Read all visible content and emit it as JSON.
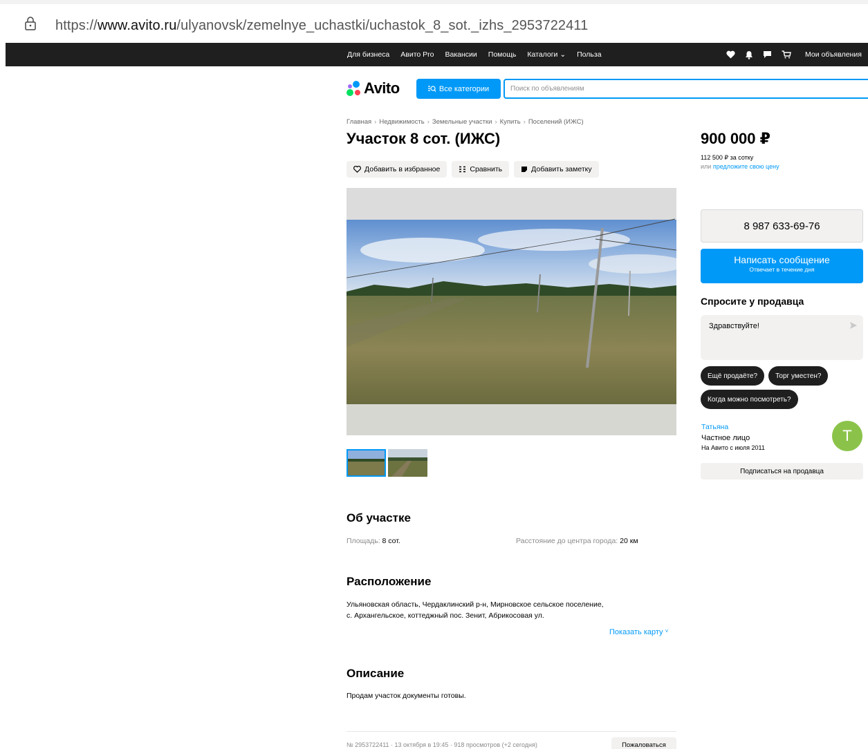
{
  "browser": {
    "url_prefix": "https://",
    "url_host": "www.avito.ru",
    "url_path": "/ulyanovsk/zemelnye_uchastki/uchastok_8_sot._izhs_2953722411"
  },
  "topnav": {
    "links": [
      "Для бизнеса",
      "Авито Pro",
      "Вакансии",
      "Помощь",
      "Каталоги",
      "Польза"
    ],
    "my_ads": "Мои объявления"
  },
  "header": {
    "logo": "Avito",
    "categories_button": "Все категории",
    "search_placeholder": "Поиск по объявлениям"
  },
  "breadcrumb": [
    "Главная",
    "Недвижимость",
    "Земельные участки",
    "Купить",
    "Поселений (ИЖС)"
  ],
  "listing": {
    "title": "Участок 8 сот. (ИЖС)",
    "actions": {
      "favorite": "Добавить в избранное",
      "compare": "Сравнить",
      "note": "Добавить заметку"
    },
    "photo_count": 2
  },
  "about": {
    "heading": "Об участке",
    "area_label": "Площадь:",
    "area_value": "8 сот.",
    "distance_label": "Расстояние до центра города:",
    "distance_value": "20 км"
  },
  "location": {
    "heading": "Расположение",
    "address": "Ульяновская область, Чердаклинский р-н, Мирновское сельское поселение, с. Архангельское, коттеджный пос. Зенит, Абрикосовая ул.",
    "show_map": "Показать карту"
  },
  "description": {
    "heading": "Описание",
    "text": "Продам участок документы готовы."
  },
  "footer": {
    "meta": "№ 2953722411 · 13 октября в 19:45 · 918 просмотров (+2 сегодня)",
    "complain": "Пожаловаться"
  },
  "sidebar": {
    "price": "900 000 ₽",
    "per_sotka": "112 500 ₽ за сотку",
    "offer_prefix": "или",
    "offer_link": "предложите свою цену",
    "phone": "8 987 633-69-76",
    "message_button": "Написать сообщение",
    "message_sub": "Отвечает в течение дня",
    "ask_title": "Спросите у продавца",
    "ask_text": "Здравствуйте!",
    "chips": [
      "Ещё продаёте?",
      "Торг уместен?",
      "Когда можно посмотреть?"
    ],
    "seller_name": "Татьяна",
    "seller_type": "Частное лицо",
    "seller_since": "На Авито с июля 2011",
    "avatar_letter": "Т",
    "subscribe": "Подписаться на продавца"
  },
  "colors": {
    "accent": "#0099f7",
    "dark": "#1f1f1f",
    "avatar": "#8bc34a",
    "button_bg": "#f2f1f0"
  }
}
